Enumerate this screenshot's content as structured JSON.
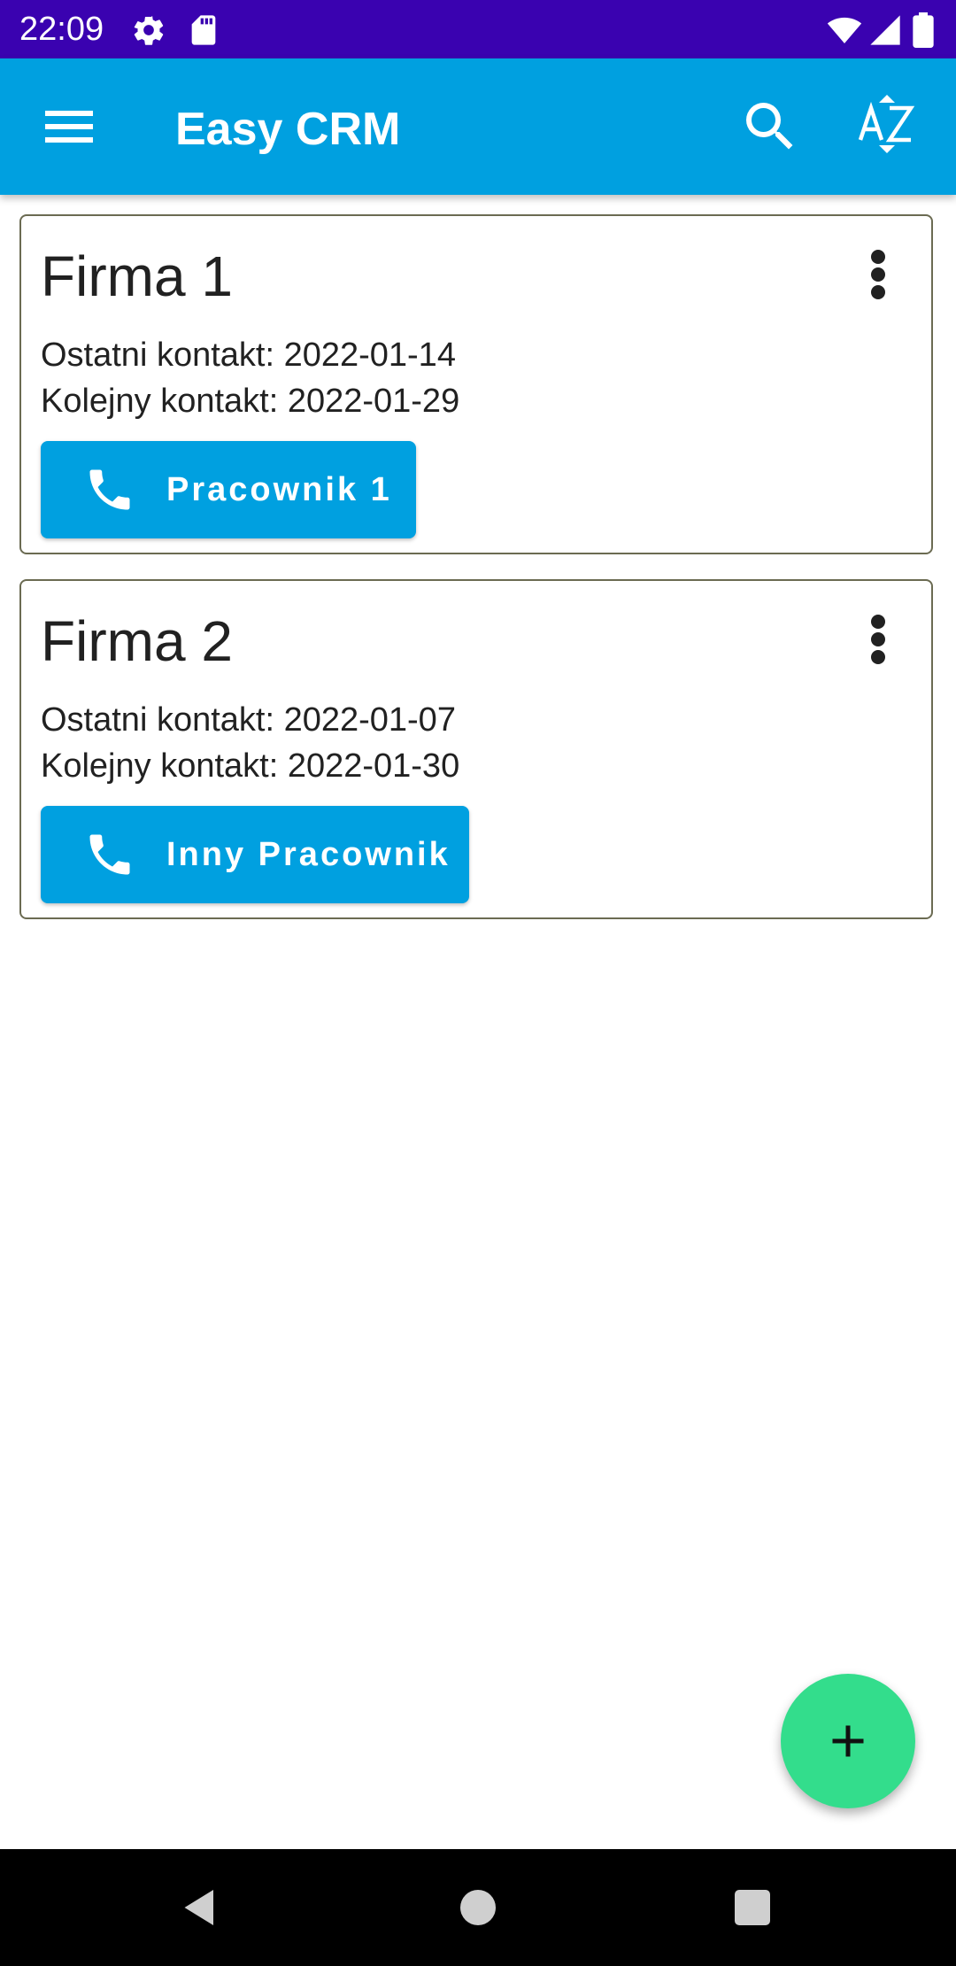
{
  "status_bar": {
    "time": "22:09",
    "icons": [
      "settings-icon",
      "sd-card-icon",
      "wifi-icon",
      "signal-icon",
      "battery-icon"
    ]
  },
  "app_bar": {
    "title": "Easy CRM",
    "icons": [
      "menu-icon",
      "search-icon",
      "sort-az-icon"
    ]
  },
  "companies": [
    {
      "name": "Firma 1",
      "last_contact": "Ostatni kontakt: 2022-01-14",
      "next_contact": "Kolejny kontakt: 2022-01-29",
      "contact_button": "Pracownik 1"
    },
    {
      "name": "Firma 2",
      "last_contact": "Ostatni kontakt: 2022-01-07",
      "next_contact": "Kolejny kontakt: 2022-01-30",
      "contact_button": "Inny Pracownik"
    }
  ],
  "fab": {
    "icon": "plus-icon"
  },
  "nav_bar": {
    "icons": [
      "back-icon",
      "home-icon",
      "recents-icon"
    ]
  },
  "colors": {
    "status_bar": "#3a02b0",
    "app_bar": "#00a0e0",
    "button": "#00a0e0",
    "fab": "#33dd8c",
    "card_border": "#6b6b52"
  }
}
